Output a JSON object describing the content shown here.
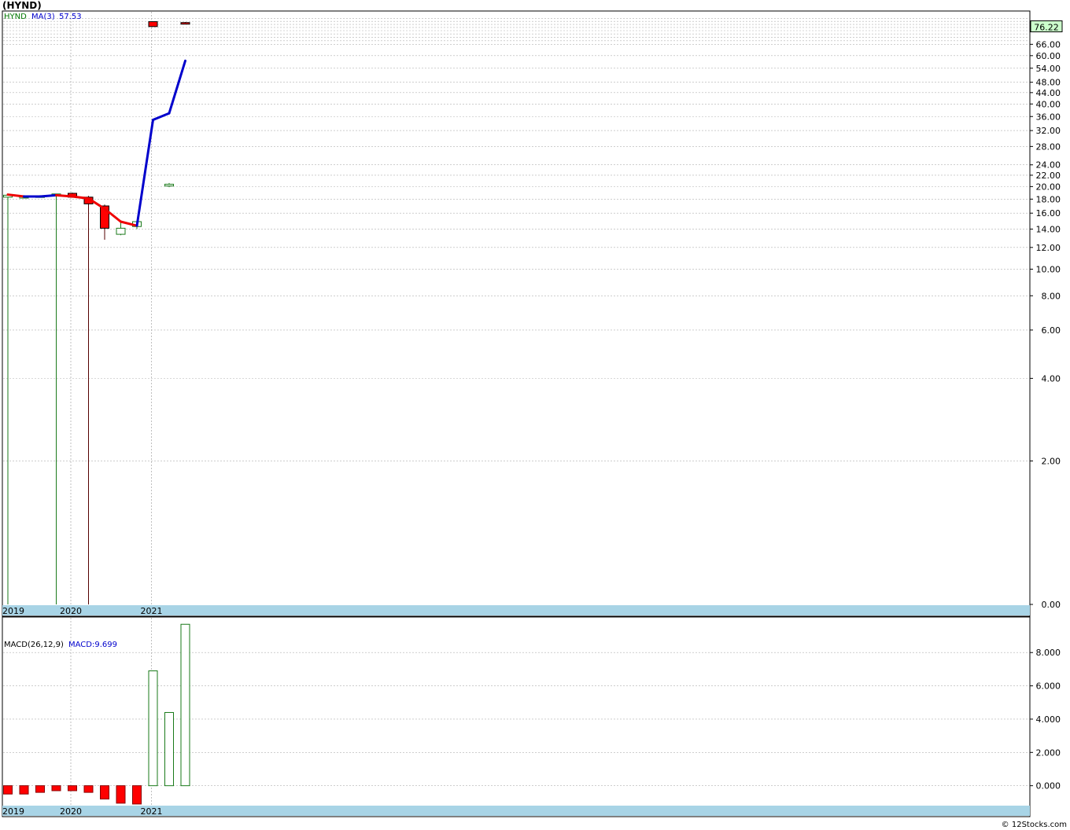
{
  "title": "(HYND)",
  "watermark": "© 12Stocks.com",
  "colors": {
    "up": "#1a7a1a",
    "down": "#ff0000",
    "ma_rising": "#0000cc",
    "ma_falling": "#ee0000",
    "last_price_bg": "#ccffcc",
    "date_strip": "#a8d4e6",
    "grid": "#b0b0b0",
    "legend_green": "#007700",
    "legend_blue": "#0000cc"
  },
  "chart_data": [
    {
      "type": "candlestick",
      "panel": "price",
      "legend": {
        "symbol": "HYND",
        "ma_label": "MA(3)",
        "ma_value": "57.53"
      },
      "last_price": "76.22",
      "y_scale": "log",
      "yticks": [
        "66.00",
        "60.00",
        "54.00",
        "48.00",
        "44.00",
        "40.00",
        "36.00",
        "32.00",
        "28.00",
        "24.00",
        "22.00",
        "20.00",
        "18.00",
        "16.00",
        "14.00",
        "12.00",
        "10.00",
        "8.00",
        "6.00",
        "4.00",
        "2.00",
        "0.00"
      ],
      "x_labels": [
        "2019",
        "2020",
        "2021"
      ],
      "period": "monthly",
      "candles": [
        {
          "o": 18.3,
          "h": 18.6,
          "l": 0.01,
          "c": 18.6
        },
        {
          "o": 18.4,
          "h": 18.6,
          "l": 18.1,
          "c": 18.4
        },
        {
          "o": 18.5,
          "h": 18.6,
          "l": 18.4,
          "c": 18.5
        },
        {
          "o": 18.6,
          "h": 18.8,
          "l": 0.01,
          "c": 18.8
        },
        {
          "o": 18.9,
          "h": 19.0,
          "l": 18.2,
          "c": 18.3
        },
        {
          "o": 18.3,
          "h": 18.5,
          "l": 0.01,
          "c": 17.3
        },
        {
          "o": 17.0,
          "h": 17.2,
          "l": 12.8,
          "c": 14.1
        },
        {
          "o": 13.4,
          "h": 14.9,
          "l": 13.3,
          "c": 14.1
        },
        {
          "o": 14.3,
          "h": 15.0,
          "l": 14.0,
          "c": 14.9
        },
        {
          "o": 79.8,
          "h": 80.0,
          "l": 76.5,
          "c": 76.6
        },
        {
          "o": 20.1,
          "h": 20.6,
          "l": 19.9,
          "c": 20.4
        },
        {
          "o": 79.2,
          "h": 79.6,
          "l": 78.8,
          "c": 79.0
        }
      ],
      "ma": [
        18.7,
        18.4,
        18.4,
        18.6,
        18.4,
        18.1,
        16.6,
        14.9,
        14.4,
        35.0,
        37.0,
        57.5
      ]
    },
    {
      "type": "bar",
      "panel": "macd",
      "legend": {
        "label": "MACD(26,12,9)",
        "macd_label": "MACD:9.699"
      },
      "yticks": [
        "8.000",
        "6.000",
        "4.000",
        "2.000",
        "0.000"
      ],
      "ylim": [
        -1.15,
        9.9
      ],
      "x_labels": [
        "2019",
        "2020",
        "2021"
      ],
      "values": [
        -0.5,
        -0.5,
        -0.4,
        -0.3,
        -0.3,
        -0.4,
        -0.8,
        -1.05,
        -1.1,
        6.9,
        4.4,
        9.699
      ]
    }
  ]
}
